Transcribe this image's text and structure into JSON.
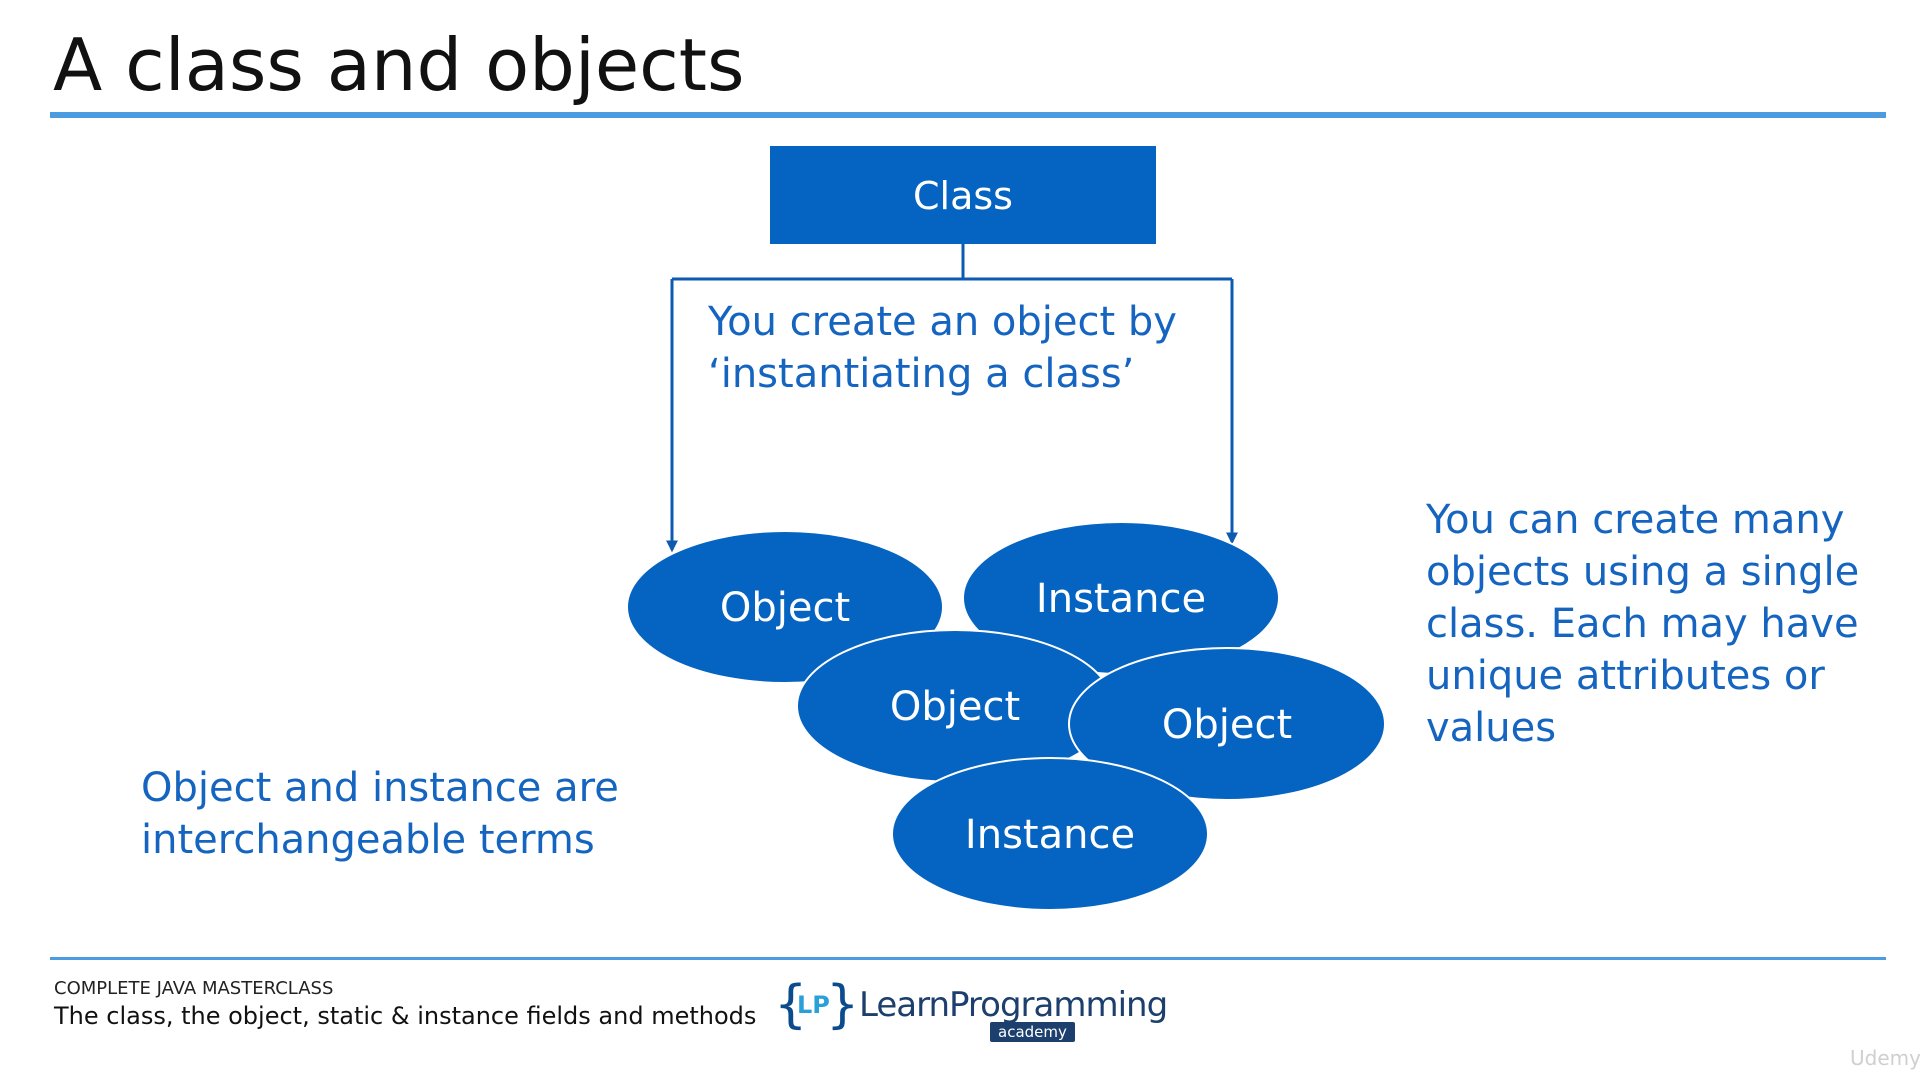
{
  "slide": {
    "title": "A class and objects"
  },
  "diagram": {
    "class_box": "Class",
    "note_instantiate": [
      "You create an object by",
      "‘instantiating a class’"
    ],
    "nodes": [
      {
        "label": "Object"
      },
      {
        "label": "Instance"
      },
      {
        "label": "Object"
      },
      {
        "label": "Object"
      },
      {
        "label": "Instance"
      }
    ],
    "colors": {
      "fill": "#0563c1",
      "text": "#ffffff",
      "line": "#0d5bb0",
      "note_text": "#1565c0",
      "rule": "#4a9be0"
    }
  },
  "notes": {
    "many_objects": [
      "You can create many",
      "objects using a single",
      "class. Each may have",
      "unique attributes or",
      "values"
    ],
    "interchangeable": [
      "Object and instance are",
      "interchangeable terms"
    ]
  },
  "footer": {
    "course": "COMPLETE JAVA MASTERCLASS",
    "topic": "The class, the object, static & instance fields and methods",
    "logo_mark": "LP",
    "logo_word": "LearnProgramming",
    "logo_sub": "academy",
    "logo_brace_left": "{",
    "logo_brace_right": "}",
    "logo_icon": "learn-programming-logo-icon",
    "watermark": "Udemy"
  }
}
